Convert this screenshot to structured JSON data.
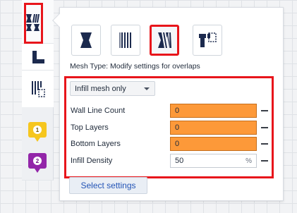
{
  "toolbar": {
    "tools": [
      {
        "name": "per-model-settings-icon"
      },
      {
        "name": "support-blocker-icon"
      },
      {
        "name": "mirror-icon"
      }
    ],
    "extensions": [
      {
        "badge": "1",
        "color": "#f6c61e"
      },
      {
        "badge": "2",
        "color": "#9326a9"
      }
    ]
  },
  "panel": {
    "mesh_types": [
      {
        "name": "normal-model-icon",
        "active": false
      },
      {
        "name": "support-mesh-icon",
        "active": false
      },
      {
        "name": "overlap-mesh-icon",
        "active": true
      },
      {
        "name": "anti-overhang-mesh-icon",
        "active": false
      }
    ],
    "mesh_type_label": "Mesh Type: Modify settings for overlaps",
    "dropdown_value": "Infill mesh only",
    "settings": [
      {
        "label": "Wall Line Count",
        "value": "0",
        "unit": "",
        "highlighted": true
      },
      {
        "label": "Top Layers",
        "value": "0",
        "unit": "",
        "highlighted": true
      },
      {
        "label": "Bottom Layers",
        "value": "0",
        "unit": "",
        "highlighted": true
      },
      {
        "label": "Infill Density",
        "value": "50",
        "unit": "%",
        "highlighted": false
      }
    ],
    "select_settings_label": "Select settings"
  },
  "colors": {
    "accent_red": "#e8151b",
    "field_orange": "#fd9939",
    "link_blue": "#2354b6"
  }
}
